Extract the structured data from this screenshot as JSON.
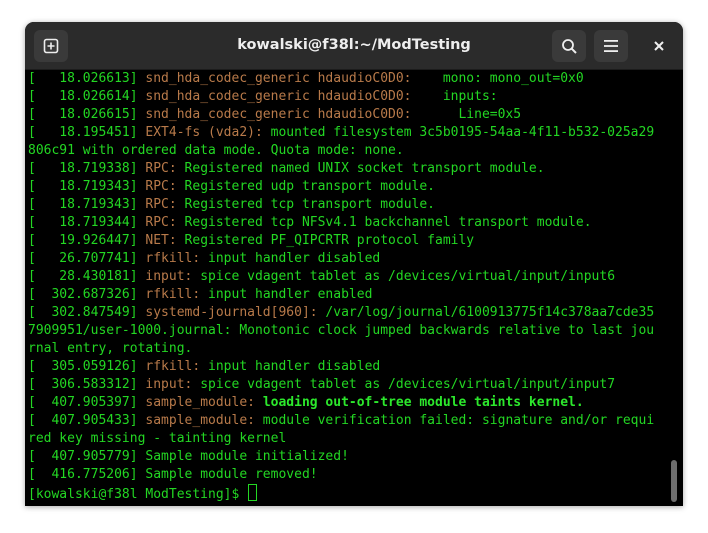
{
  "window": {
    "title": "kowalski@f38l:~/ModTesting",
    "buttons": {
      "new_tab": "new-tab-icon",
      "search": "search-icon",
      "menu": "hamburger-menu-icon",
      "close": "close-icon"
    }
  },
  "terminal": {
    "lines": [
      {
        "ts": "[   18.026613] ",
        "tag": "snd_hda_codec_generic hdaudioC0D0:",
        "msg": "    mono: mono_out=0x0"
      },
      {
        "ts": "[   18.026614] ",
        "tag": "snd_hda_codec_generic hdaudioC0D0:",
        "msg": "    inputs:"
      },
      {
        "ts": "[   18.026615] ",
        "tag": "snd_hda_codec_generic hdaudioC0D0:",
        "msg": "      Line=0x5"
      },
      {
        "ts": "[   18.195451] ",
        "tag": "EXT4-fs (vda2):",
        "msg": " mounted filesystem 3c5b0195-54aa-4f11-b532-025a29"
      },
      {
        "ts": "",
        "tag": "",
        "msg": "806c91 with ordered data mode. Quota mode: none."
      },
      {
        "ts": "[   18.719338] ",
        "tag": "RPC:",
        "msg": " Registered named UNIX socket transport module."
      },
      {
        "ts": "[   18.719343] ",
        "tag": "RPC:",
        "msg": " Registered udp transport module."
      },
      {
        "ts": "[   18.719343] ",
        "tag": "RPC:",
        "msg": " Registered tcp transport module."
      },
      {
        "ts": "[   18.719344] ",
        "tag": "RPC:",
        "msg": " Registered tcp NFSv4.1 backchannel transport module."
      },
      {
        "ts": "[   19.926447] ",
        "tag": "NET:",
        "msg": " Registered PF_QIPCRTR protocol family"
      },
      {
        "ts": "[   26.707741] ",
        "tag": "rfkill:",
        "msg": " input handler disabled"
      },
      {
        "ts": "[   28.430181] ",
        "tag": "input:",
        "msg": " spice vdagent tablet as /devices/virtual/input/input6"
      },
      {
        "ts": "[  302.687326] ",
        "tag": "rfkill:",
        "msg": " input handler enabled"
      },
      {
        "ts": "[  302.847549] ",
        "tag": "systemd-journald[960]:",
        "msg": " /var/log/journal/6100913775f14c378aa7cde35"
      },
      {
        "ts": "",
        "tag": "",
        "msg": "7909951/user-1000.journal: Monotonic clock jumped backwards relative to last jou"
      },
      {
        "ts": "",
        "tag": "",
        "msg": "rnal entry, rotating."
      },
      {
        "ts": "[  305.059126] ",
        "tag": "rfkill:",
        "msg": " input handler disabled"
      },
      {
        "ts": "[  306.583312] ",
        "tag": "input:",
        "msg": " spice vdagent tablet as /devices/virtual/input/input7"
      },
      {
        "ts": "[  407.905397] ",
        "tag": "sample_module:",
        "msg": " ",
        "bold": "loading out-of-tree module taints kernel."
      },
      {
        "ts": "[  407.905433] ",
        "tag": "sample_module:",
        "msg": " module verification failed: signature and/or requi"
      },
      {
        "ts": "",
        "tag": "",
        "msg": "red key missing - tainting kernel"
      },
      {
        "ts": "[  407.905779] ",
        "tag": "",
        "msg": "Sample module initialized!"
      },
      {
        "ts": "[  416.775206] ",
        "tag": "",
        "msg": "Sample module removed!"
      }
    ],
    "prompt": "[kowalski@f38l ModTesting]$ "
  },
  "colors": {
    "terminal_bg": "#000000",
    "terminal_fg": "#23d723",
    "tag": "#b87a4a",
    "titlebar": "#2b2b2b"
  }
}
